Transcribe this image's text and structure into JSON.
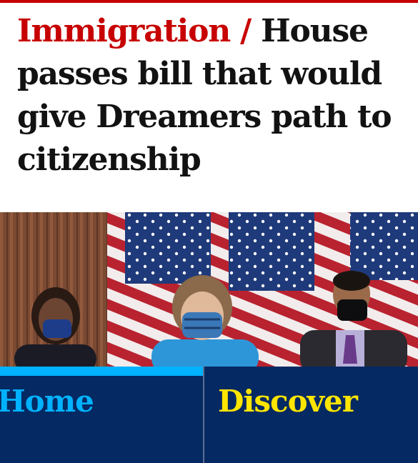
{
  "article": {
    "section": "Immigration",
    "separator": " / ",
    "title": "House passes bill that would give Dreamers path to citizenship"
  },
  "nav": {
    "items": [
      {
        "label": "Home",
        "active": true
      },
      {
        "label": "Discover",
        "active": false
      }
    ]
  },
  "colors": {
    "kicker": "#c70000",
    "nav_background": "#052962",
    "home_active": "#00b2ff",
    "discover": "#ffe500"
  }
}
